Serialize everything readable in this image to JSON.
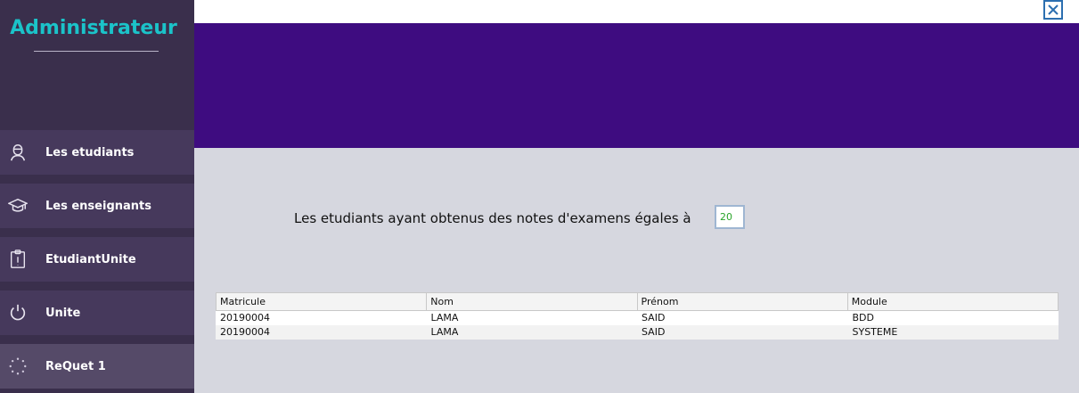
{
  "sidebar": {
    "title": "Administrateur",
    "items": [
      {
        "label": "Les etudiants",
        "icon": "student-icon"
      },
      {
        "label": "Les enseignants",
        "icon": "graduation-cap-icon"
      },
      {
        "label": "EtudiantUnite",
        "icon": "clipboard-alert-icon"
      },
      {
        "label": "Unite",
        "icon": "power-icon"
      },
      {
        "label": "ReQuet 1",
        "icon": "loading-dots-icon"
      }
    ]
  },
  "query": {
    "label": "Les etudiants ayant obtenus des notes d'examens égales à",
    "value": "20"
  },
  "table": {
    "columns": [
      "Matricule",
      "Nom",
      "Prénom",
      "Module"
    ],
    "rows": [
      [
        "20190004",
        "LAMA",
        "SAID",
        "BDD"
      ],
      [
        "20190004",
        "LAMA",
        "SAID",
        "SYSTEME"
      ]
    ]
  },
  "colors": {
    "sidebar_bg": "#3a2f4c",
    "brand": "#1bc3c9",
    "banner": "#3e0c80",
    "content_bg": "#d6d7df"
  }
}
